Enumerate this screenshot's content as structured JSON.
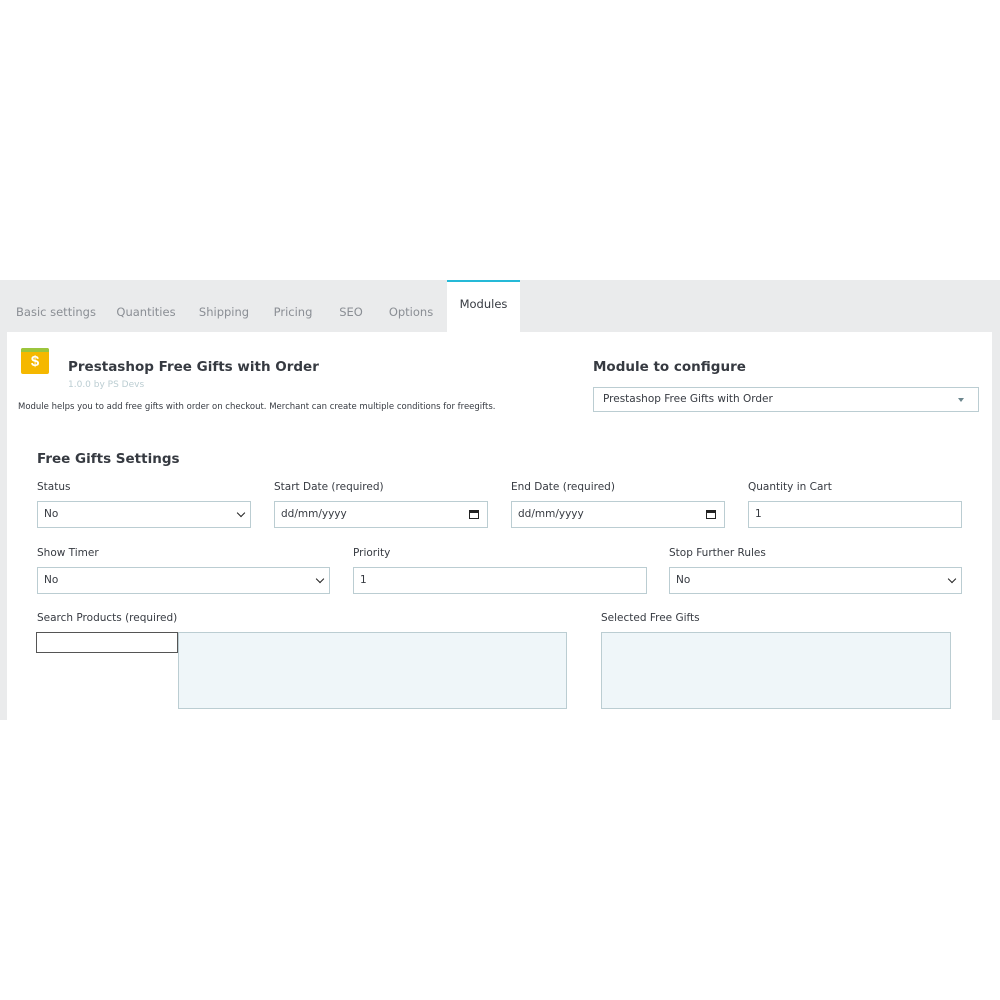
{
  "tabs": [
    {
      "label": "Basic settings"
    },
    {
      "label": "Quantities"
    },
    {
      "label": "Shipping"
    },
    {
      "label": "Pricing"
    },
    {
      "label": "SEO"
    },
    {
      "label": "Options"
    },
    {
      "label": "Modules",
      "active": true
    }
  ],
  "module": {
    "icon": "dollar-sign",
    "icon_glyph": "$",
    "name": "Prestashop Free Gifts with Order",
    "version": "1.0.0 by PS Devs",
    "description": "Module helps you to add free gifts with order on checkout. Merchant can create multiple conditions for freegifts."
  },
  "configure": {
    "title": "Module to configure",
    "selected": "Prestashop Free Gifts with Order"
  },
  "settings": {
    "title": "Free Gifts Settings",
    "status": {
      "label": "Status",
      "value": "No"
    },
    "start_date": {
      "label": "Start Date (required)",
      "value": "dd/mm/yyyy"
    },
    "end_date": {
      "label": "End Date (required)",
      "value": "dd/mm/yyyy"
    },
    "quantity": {
      "label": "Quantity in Cart",
      "value": "1"
    },
    "show_timer": {
      "label": "Show Timer",
      "value": "No"
    },
    "priority": {
      "label": "Priority",
      "value": "1"
    },
    "stop_rules": {
      "label": "Stop Further Rules",
      "value": "No"
    },
    "search_products": {
      "label": "Search Products (required)",
      "value": ""
    },
    "selected_gifts": {
      "label": "Selected Free Gifts"
    }
  },
  "colors": {
    "accent": "#25b9d7",
    "background": "#eaebec",
    "icon": "#f5b800"
  }
}
